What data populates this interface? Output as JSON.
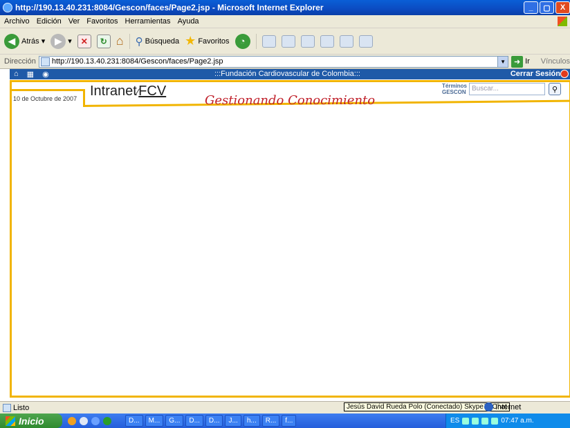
{
  "window": {
    "title": "http://190.13.40.231:8084/Gescon/faces/Page2.jsp - Microsoft Internet Explorer",
    "buttons": [
      "_",
      "▢",
      "X"
    ]
  },
  "menu": [
    "Archivo",
    "Edición",
    "Ver",
    "Favoritos",
    "Herramientas",
    "Ayuda"
  ],
  "toolbar": {
    "back_label": "Atrás",
    "search_label": "Búsqueda",
    "favorites_label": "Favoritos"
  },
  "address": {
    "label": "Dirección",
    "url": "http://190.13.40.231:8084/Gescon/faces/Page2.jsp",
    "go_label": "Ir",
    "links_label": "Vínculos"
  },
  "page": {
    "org_title": ":::Fundación Cardiovascular de Colombia:::",
    "logout_label": "Cerrar Sesión",
    "date": "10 de Octubre de 2007",
    "brand_intranet": "Intranet",
    "brand_fcv": "FCV",
    "slogan": "Gestionando Conocimiento",
    "terms_line1": "Términos",
    "terms_line2": "GESCON",
    "search_placeholder": "Buscar..."
  },
  "status": {
    "text": "Listo",
    "tooltip": "Jesús David Rueda Polo (Conectado) Skype™ Chat",
    "zone": "Internet"
  },
  "taskbar": {
    "start_label": "Inicio",
    "tasks": [
      "D...",
      "M...",
      "G...",
      "D...",
      "D...",
      "J...",
      "h...",
      "R...",
      "f..."
    ],
    "lang": "ES",
    "time": "07:47 a.m."
  },
  "colors": {
    "accent_gold": "#f1b400",
    "header_blue": "#1f5aa8",
    "slogan_red": "#c0202a"
  }
}
